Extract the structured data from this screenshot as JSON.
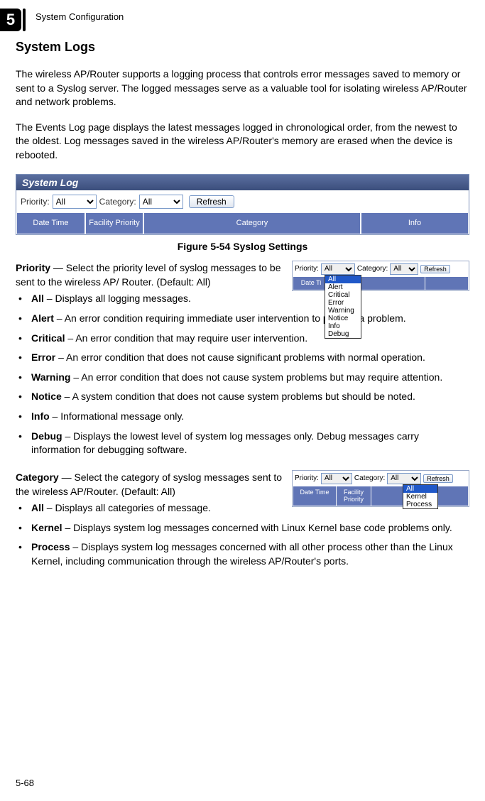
{
  "chapter": {
    "number": "5",
    "label": "System Configuration"
  },
  "section_title": "System Logs",
  "para1": "The wireless AP/Router supports a logging process that controls error messages saved to memory or sent to a Syslog server. The logged messages serve as a valuable tool for isolating wireless AP/Router and network problems.",
  "para2": "The Events Log page displays the latest messages logged in chronological order, from the newest to the oldest. Log messages saved in the wireless AP/Router's memory are erased when the device is rebooted.",
  "figure_main": {
    "title": "System Log",
    "priority_label": "Priority:",
    "category_label": "Category:",
    "refresh": "Refresh",
    "priority_value": "All",
    "category_value": "All",
    "headers": {
      "datetime": "Date Time",
      "facility": "Facility Priority",
      "category": "Category",
      "info": "Info"
    },
    "caption": "Figure 5-54  Syslog Settings"
  },
  "priority_def": {
    "term": "Priority",
    "text": " — Select the priority level of syslog messages to be sent to the wireless AP/ Router. (Default: All)"
  },
  "priority_bullets": [
    {
      "b": "All",
      "t": " – Displays all logging messages."
    },
    {
      "b": "Alert",
      "t": " – An error condition requiring immediate user intervention to prevent a problem."
    },
    {
      "b": "Critical",
      "t": " – An error condition that may require user intervention."
    },
    {
      "b": "Error",
      "t": " – An error condition that does not cause significant problems with normal operation."
    },
    {
      "b": "Warning",
      "t": " – An error condition that does not cause system problems but may require attention."
    },
    {
      "b": "Notice",
      "t": " – A system condition that does not cause system problems but should be noted."
    },
    {
      "b": "Info",
      "t": " – Informational message only."
    },
    {
      "b": "Debug",
      "t": " – Displays the lowest level of system log messages only. Debug messages carry information for debugging software."
    }
  ],
  "priority_dropdown": [
    "All",
    "Alert",
    "Critical",
    "Error",
    "Warning",
    "Notice",
    "Info",
    "Debug"
  ],
  "category_def": {
    "term": "Category",
    "text": " — Select the category of syslog messages sent to the wireless AP/Router. (Default: All)"
  },
  "category_bullets": [
    {
      "b": "All",
      "t": " – Displays all categories of message."
    },
    {
      "b": "Kernel",
      "t": " – Displays system log messages concerned with Linux Kernel base code problems only."
    },
    {
      "b": "Process",
      "t": " – Displays system log messages concerned with all other process other than the Linux Kernel, including communication through the wireless AP/Router's ports."
    }
  ],
  "category_dropdown": [
    "All",
    "Kernel",
    "Process"
  ],
  "mini": {
    "priority_label": "Priority:",
    "category_label": "Category:",
    "refresh": "Refresh",
    "all": "All",
    "headers": {
      "dt": "Date Ti",
      "fp": "Facility Priority",
      "ority": "ority"
    }
  },
  "page_number": "5-68"
}
